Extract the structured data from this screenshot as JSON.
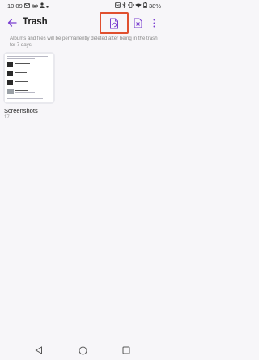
{
  "status_bar": {
    "time": "10:09",
    "battery": "38%",
    "left_icons": [
      "message-icon",
      "voicemail-icon",
      "person-icon",
      "dot-icon"
    ],
    "right_icons": [
      "nfc-icon",
      "bluetooth-icon",
      "vibrate-icon",
      "wifi-icon",
      "battery-icon"
    ]
  },
  "app_bar": {
    "title": "Trash",
    "actions": [
      "restore-all-icon",
      "empty-trash-icon",
      "more-options-icon"
    ]
  },
  "info": {
    "text": "Albums and files will be permanently deleted after being in the trash for 7 days."
  },
  "album": {
    "name": "Screenshots",
    "count": "17"
  },
  "nav_bar": {
    "buttons": [
      "back-triangle-icon",
      "home-circle-icon",
      "recents-square-icon"
    ]
  },
  "colors": {
    "accent": "#7a3fd0",
    "highlight_box": "#e0502f",
    "background": "#f7f6f9"
  }
}
